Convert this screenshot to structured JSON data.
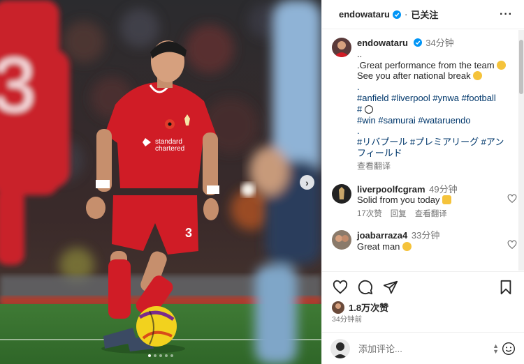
{
  "header": {
    "username": "endowataru",
    "separator": "·",
    "follow_status": "已关注",
    "more_icon": "more-horizontal-icon"
  },
  "caption": {
    "username": "endowataru",
    "time": "34分钟",
    "lines": [
      "..",
      ".Great performance from the team",
      "See you after national break",
      ".",
      "#anfield #liverpool #ynwa #football",
      "#",
      "#win #samurai #wataruendo",
      ".",
      "#リバプール #プレミアリーグ #アン",
      "フィールド"
    ],
    "translate": "查看翻译"
  },
  "comments": [
    {
      "username": "liverpoolfcgram",
      "time": "49分钟",
      "text": "Solid from you today",
      "likes": "17次赞",
      "reply": "回复",
      "translate": "查看翻译"
    },
    {
      "username": "joabarraza4",
      "time": "33分钟",
      "text": "Great man"
    }
  ],
  "footer": {
    "likes": "1.8万次赞",
    "posted": "34分钟前",
    "comment_placeholder": "添加评论..."
  },
  "photo": {
    "sponsor": "Standard Chartered",
    "shirt_number": "3",
    "slide_dots": 5,
    "active_dot": 0
  },
  "colors": {
    "link": "#00376b",
    "verified": "#0095f6",
    "jersey": "#d01c26"
  }
}
